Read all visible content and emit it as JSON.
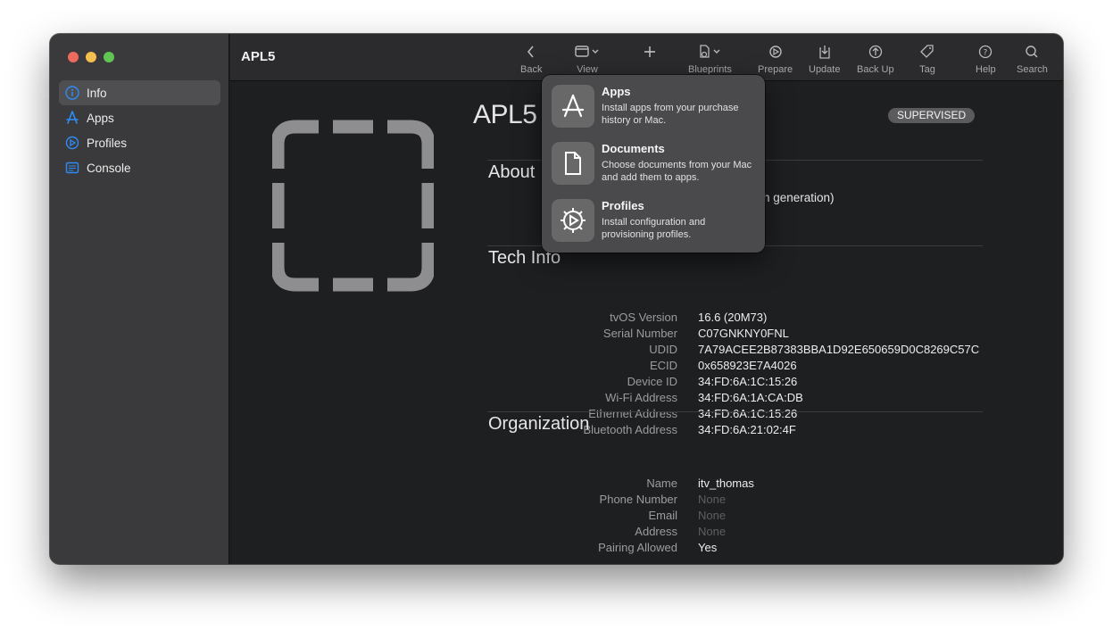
{
  "window": {
    "title": "APL5"
  },
  "sidebar": {
    "items": [
      {
        "label": "Info",
        "icon": "info-icon",
        "active": true
      },
      {
        "label": "Apps",
        "icon": "apps-icon",
        "active": false
      },
      {
        "label": "Profiles",
        "icon": "profiles-icon",
        "active": false
      },
      {
        "label": "Console",
        "icon": "console-icon",
        "active": false
      }
    ]
  },
  "toolbar": {
    "back": "Back",
    "view": "View",
    "blueprints": "Blueprints",
    "prepare": "Prepare",
    "update": "Update",
    "backup": "Back Up",
    "tag": "Tag",
    "help": "Help",
    "search": "Search"
  },
  "device": {
    "name": "APL5",
    "badge": "SUPERVISED",
    "about_partial": "h generation)"
  },
  "sections": {
    "about": "About",
    "tech": "Tech Info",
    "org": "Organization"
  },
  "tech_info": [
    {
      "k": "tvOS Version",
      "v": "16.6 (20M73)"
    },
    {
      "k": "Serial Number",
      "v": "C07GNKNY0FNL"
    },
    {
      "k": "UDID",
      "v": "7A79ACEE2B87383BBA1D92E650659D0C8269C57C"
    },
    {
      "k": "ECID",
      "v": "0x658923E7A4026"
    },
    {
      "k": "Device ID",
      "v": "34:FD:6A:1C:15:26"
    },
    {
      "k": "Wi-Fi Address",
      "v": "34:FD:6A:1A:CA:DB"
    },
    {
      "k": "Ethernet Address",
      "v": "34:FD:6A:1C:15:26"
    },
    {
      "k": "Bluetooth Address",
      "v": "34:FD:6A:21:02:4F"
    }
  ],
  "organization": [
    {
      "k": "Name",
      "v": "itv_thomas"
    },
    {
      "k": "Phone Number",
      "v": "None"
    },
    {
      "k": "Email",
      "v": "None"
    },
    {
      "k": "Address",
      "v": "None"
    },
    {
      "k": "Pairing Allowed",
      "v": "Yes"
    }
  ],
  "popover": {
    "items": [
      {
        "title": "Apps",
        "desc": "Install apps from your purchase history or Mac.",
        "icon": "app-store-icon"
      },
      {
        "title": "Documents",
        "desc": "Choose documents from your Mac and add them to apps.",
        "icon": "document-icon"
      },
      {
        "title": "Profiles",
        "desc": "Install configuration and provisioning profiles.",
        "icon": "profile-gear-icon"
      }
    ]
  },
  "colors": {
    "accent": "#2f8cf5",
    "window_bg": "#1e1f21",
    "sidebar_bg": "#3a3a3c"
  }
}
